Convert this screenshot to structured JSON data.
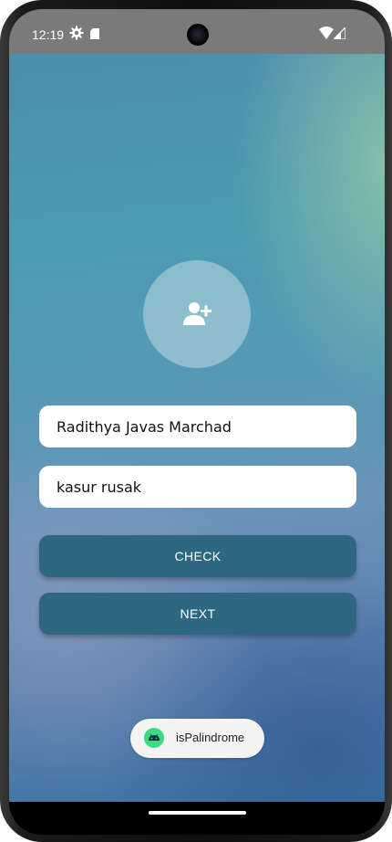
{
  "status_bar": {
    "time": "12:19",
    "icons": [
      "gear-icon",
      "sd-card-icon",
      "wifi-icon",
      "signal-icon"
    ]
  },
  "avatar": {
    "icon": "add-user-icon"
  },
  "form": {
    "name_value": "Radithya Javas Marchad",
    "sentence_value": "kasur rusak"
  },
  "buttons": {
    "check_label": "CHECK",
    "next_label": "NEXT"
  },
  "toast": {
    "icon": "android-icon",
    "text": "isPalindrome"
  },
  "colors": {
    "button": "#2d6880",
    "android_green": "#3ddc84"
  }
}
